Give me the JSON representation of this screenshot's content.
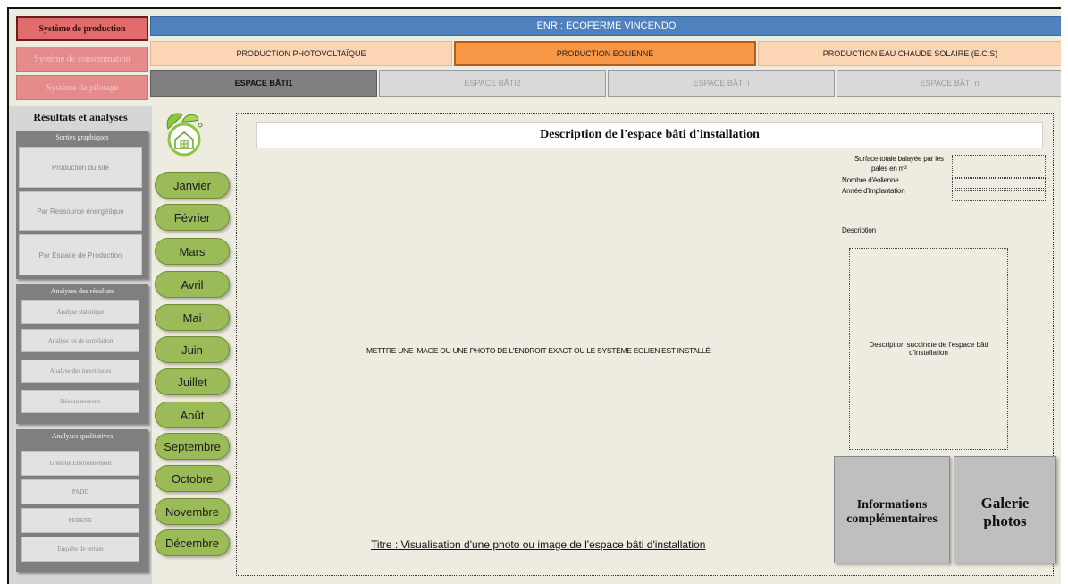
{
  "system_nav": {
    "production": "Système de production",
    "consommation": "Système de consommation",
    "pilotage": "Système de pilotage"
  },
  "header": {
    "title": "ENR : ECOFERME VINCENDO"
  },
  "production_tabs": [
    {
      "label": "PRODUCTION PHOTOVOLTAÏQUE",
      "active": false
    },
    {
      "label": "PRODUCTION EOLIENNE",
      "active": true
    },
    {
      "label": "PRODUCTION EAU CHAUDE SOLAIRE (E.C.S)",
      "active": false
    }
  ],
  "espace_tabs": [
    {
      "label": "ESPACE BÂTI1",
      "active": true
    },
    {
      "label": "ESPACE BÂTI2",
      "active": false
    },
    {
      "label": "ESPACE BÂTI i",
      "active": false
    },
    {
      "label": "ESPACE BÂTI n",
      "active": false
    }
  ],
  "sidebar": {
    "title": "Résultats et analyses",
    "sorties": {
      "title": "Sorties graphiques",
      "items": [
        "Production du site",
        "Par Ressource énergétique",
        "Par Espace de Production"
      ]
    },
    "analyses_resultats": {
      "title": "Analyses des résultats",
      "items": [
        "Analyse statistique",
        "Analyse loi de corrélation",
        "Analyse des incertitudes",
        "Réseau neurone"
      ]
    },
    "analyses_qualitatives": {
      "title": "Analyses qualitatives",
      "items": [
        "Grenelle Environnement",
        "PADD",
        "PERENE",
        "Enquête de terrain"
      ]
    }
  },
  "logo_icon": "eco-house-leaf-icon",
  "months": [
    "Janvier",
    "Février",
    "Mars",
    "Avril",
    "Mai",
    "Juin",
    "Juillet",
    "Août",
    "Septembre",
    "Octobre",
    "Novembre",
    "Décembre"
  ],
  "main": {
    "title": "Description de l'espace bâti d'installation",
    "image_placeholder": "METTRE UNE IMAGE OU UNE PHOTO DE L'ENDROIT EXACT OU LE SYSTÈME EOLIEN EST INSTALLÉ",
    "caption": "Titre : Visualisation d'une photo ou image de l'espace bâti d'installation",
    "fields": {
      "surface_line1": "Surface totale balayée par les",
      "surface_line2": "pales en m²",
      "nombre": "Nombre d'éolienne",
      "annee": "Année d'implantation",
      "description": "Description"
    },
    "description_box": "Description succincte de l'espace bâti d'installation",
    "buttons": {
      "informations": "Informations complémentaires",
      "galerie": "Galerie photos"
    }
  },
  "colors": {
    "active_system": "#e26b6b",
    "header_blue": "#4e81bd",
    "tab_orange": "#fcd5b4",
    "tab_orange_active": "#f79646",
    "month_green": "#9bbb59",
    "background": "#eeece1"
  }
}
